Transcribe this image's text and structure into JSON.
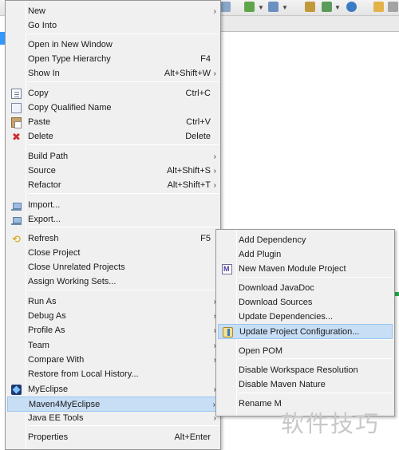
{
  "main_menu": {
    "items": [
      {
        "label": "New",
        "accel": "",
        "submenu": true,
        "icon": ""
      },
      {
        "label": "Go Into",
        "accel": "",
        "submenu": false,
        "icon": ""
      },
      {
        "label": "Open in New Window",
        "accel": "",
        "submenu": false,
        "icon": ""
      },
      {
        "label": "Open Type Hierarchy",
        "accel": "F4",
        "submenu": false,
        "icon": ""
      },
      {
        "label": "Show In",
        "accel": "Alt+Shift+W",
        "submenu": true,
        "icon": ""
      },
      {
        "label": "Copy",
        "accel": "Ctrl+C",
        "submenu": false,
        "icon": "copy-icon"
      },
      {
        "label": "Copy Qualified Name",
        "accel": "",
        "submenu": false,
        "icon": "copy-qualified-name-icon"
      },
      {
        "label": "Paste",
        "accel": "Ctrl+V",
        "submenu": false,
        "icon": "paste-icon"
      },
      {
        "label": "Delete",
        "accel": "Delete",
        "submenu": false,
        "icon": "delete-icon"
      },
      {
        "label": "Build Path",
        "accel": "",
        "submenu": true,
        "icon": ""
      },
      {
        "label": "Source",
        "accel": "Alt+Shift+S",
        "submenu": true,
        "icon": ""
      },
      {
        "label": "Refactor",
        "accel": "Alt+Shift+T",
        "submenu": true,
        "icon": ""
      },
      {
        "label": "Import...",
        "accel": "",
        "submenu": false,
        "icon": "import-icon"
      },
      {
        "label": "Export...",
        "accel": "",
        "submenu": false,
        "icon": "export-icon"
      },
      {
        "label": "Refresh",
        "accel": "F5",
        "submenu": false,
        "icon": "refresh-icon"
      },
      {
        "label": "Close Project",
        "accel": "",
        "submenu": false,
        "icon": ""
      },
      {
        "label": "Close Unrelated Projects",
        "accel": "",
        "submenu": false,
        "icon": ""
      },
      {
        "label": "Assign Working Sets...",
        "accel": "",
        "submenu": false,
        "icon": ""
      },
      {
        "label": "Run As",
        "accel": "",
        "submenu": true,
        "icon": ""
      },
      {
        "label": "Debug As",
        "accel": "",
        "submenu": true,
        "icon": ""
      },
      {
        "label": "Profile As",
        "accel": "",
        "submenu": true,
        "icon": ""
      },
      {
        "label": "Team",
        "accel": "",
        "submenu": true,
        "icon": ""
      },
      {
        "label": "Compare With",
        "accel": "",
        "submenu": true,
        "icon": ""
      },
      {
        "label": "Restore from Local History...",
        "accel": "",
        "submenu": false,
        "icon": ""
      },
      {
        "label": "MyEclipse",
        "accel": "",
        "submenu": true,
        "icon": "myeclipse-icon"
      },
      {
        "label": "Maven4MyEclipse",
        "accel": "",
        "submenu": true,
        "icon": "",
        "highlighted": true
      },
      {
        "label": "Java EE Tools",
        "accel": "",
        "submenu": true,
        "icon": ""
      },
      {
        "label": "Properties",
        "accel": "Alt+Enter",
        "submenu": false,
        "icon": ""
      }
    ]
  },
  "sub_menu": {
    "items": [
      {
        "label": "Add Dependency",
        "icon": ""
      },
      {
        "label": "Add Plugin",
        "icon": ""
      },
      {
        "label": "New Maven Module Project",
        "icon": "maven-module-icon"
      },
      {
        "label": "Download JavaDoc",
        "icon": ""
      },
      {
        "label": "Download Sources",
        "icon": ""
      },
      {
        "label": "Update Dependencies...",
        "icon": ""
      },
      {
        "label": "Update Project Configuration...",
        "icon": "update-configuration-icon",
        "highlighted": true
      },
      {
        "label": "Open POM",
        "icon": ""
      },
      {
        "label": "Disable Workspace Resolution",
        "icon": ""
      },
      {
        "label": "Disable Maven Nature",
        "icon": ""
      },
      {
        "label": "Rename M",
        "icon": ""
      }
    ]
  },
  "watermark": "软件技巧",
  "colors": {
    "menu_bg": "#f0f0f0",
    "highlight_bg": "#c7def5",
    "highlight_border": "#99c6f3"
  }
}
